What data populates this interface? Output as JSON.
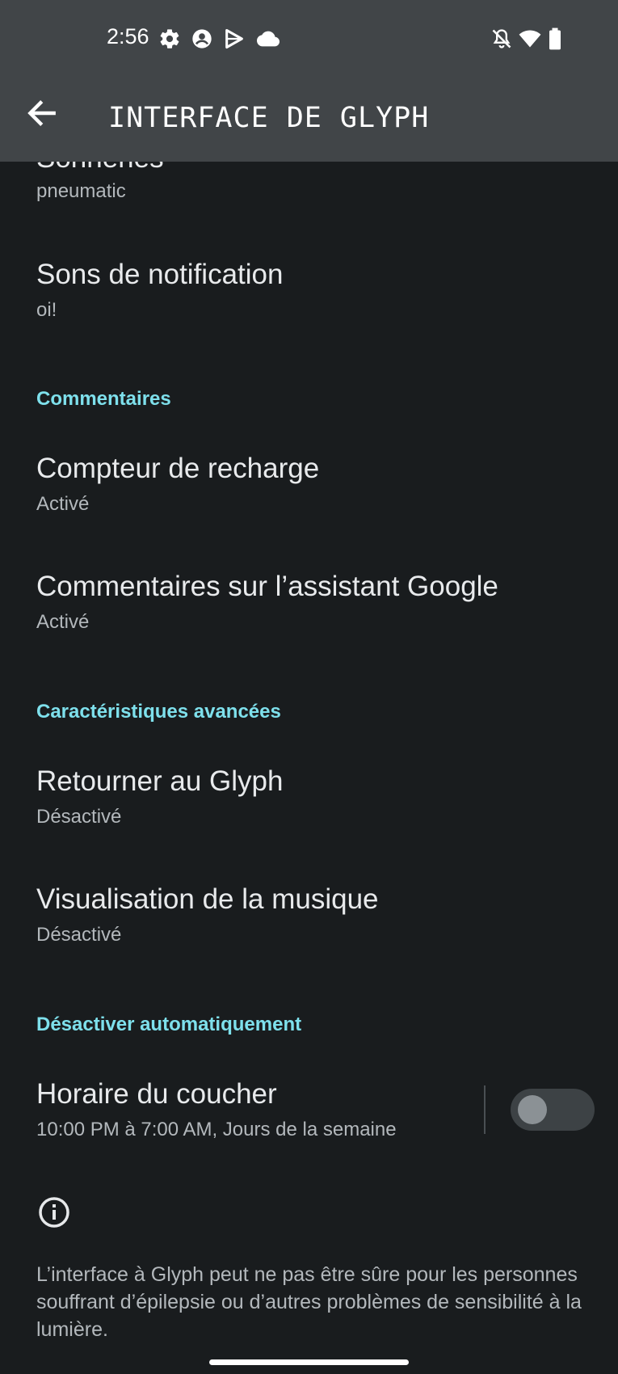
{
  "status_bar": {
    "time": "2:56",
    "icons_left": [
      "settings-icon",
      "account-icon",
      "play-icon",
      "cloud-icon"
    ],
    "icons_right": [
      "notifications-off-icon",
      "wifi-icon",
      "battery-icon"
    ]
  },
  "app_bar": {
    "title": "INTERFACE DE GLYPH",
    "back_icon": "arrow-back-icon"
  },
  "items": [
    {
      "title": "Sonneries",
      "subtitle": "pneumatic"
    },
    {
      "title": "Sons de notification",
      "subtitle": "oi!"
    },
    {
      "title": "Compteur de recharge",
      "subtitle": "Activé"
    },
    {
      "title": "Commentaires sur l’assistant Google",
      "subtitle": "Activé"
    },
    {
      "title": "Retourner au Glyph",
      "subtitle": "Désactivé"
    },
    {
      "title": "Visualisation de la musique",
      "subtitle": "Désactivé"
    },
    {
      "title": "Horaire du coucher",
      "subtitle": "10:00 PM à 7:00 AM, Jours de la semaine",
      "toggle_on": false
    }
  ],
  "sections": {
    "feedback": "Commentaires",
    "advanced": "Caractéristiques avancées",
    "auto_off": "Désactiver automatiquement"
  },
  "info": {
    "icon": "info-icon",
    "text": "L’interface à Glyph peut ne pas être sûre pour les personnes souffrant d’épilepsie ou d’autres problèmes de sensibilité à la lumière."
  },
  "colors": {
    "background": "#191c1e",
    "app_bar": "#414548",
    "section_accent": "#7ee0ec",
    "toggle_off_track": "#3d4245"
  }
}
